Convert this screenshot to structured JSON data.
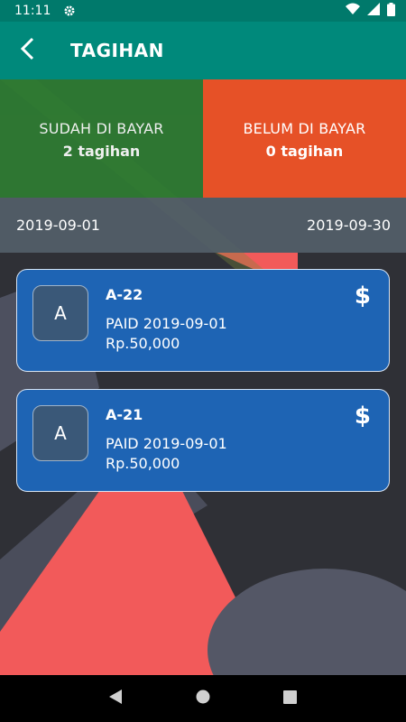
{
  "status_bar": {
    "time": "11:11"
  },
  "app_bar": {
    "title": "TAGIHAN"
  },
  "summary": {
    "paid_label": "SUDAH DI BAYAR",
    "paid_count": "2 tagihan",
    "unpaid_label": "BELUM DI BAYAR",
    "unpaid_count": "0 tagihan"
  },
  "date_range": {
    "start": "2019-09-01",
    "end": "2019-09-30"
  },
  "bills": [
    {
      "avatar": "A",
      "name": "A-22",
      "status": "PAID 2019-09-01",
      "amount": "Rp.50,000"
    },
    {
      "avatar": "A",
      "name": "A-21",
      "status": "PAID 2019-09-01",
      "amount": "Rp.50,000"
    }
  ],
  "colors": {
    "status_bar": "#00796b",
    "app_bar": "#00897b",
    "paid": "#2e7d32",
    "unpaid": "#e65127",
    "card": "#1e64b4"
  },
  "icons": [
    "settings-gear-icon",
    "wifi-icon",
    "signal-icon",
    "battery-icon",
    "back-arrow-icon",
    "dollar-icon",
    "nav-back-icon",
    "nav-home-icon",
    "nav-recents-icon"
  ]
}
